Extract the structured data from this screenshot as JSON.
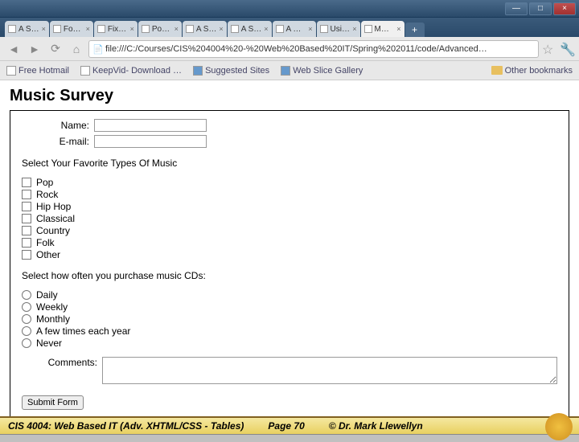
{
  "window": {
    "buttons": {
      "min": "—",
      "max": "□",
      "close": "×"
    }
  },
  "tabs": [
    {
      "label": "A S…"
    },
    {
      "label": "Fo…"
    },
    {
      "label": "Fix…"
    },
    {
      "label": "Po…"
    },
    {
      "label": "A S…"
    },
    {
      "label": "A S…"
    },
    {
      "label": "A …"
    },
    {
      "label": "Usi…"
    },
    {
      "label": "M…",
      "active": true
    }
  ],
  "nav": {
    "back": "◄",
    "forward": "►",
    "reload": "⟳",
    "home": "⌂",
    "url": "file:///C:/Courses/CIS%204004%20-%20Web%20Based%20IT/Spring%202011/code/Advanced…",
    "star": "☆",
    "wrench": "🔧"
  },
  "bookmarks": {
    "items": [
      {
        "label": "Free Hotmail"
      },
      {
        "label": "KeepVid- Download …"
      },
      {
        "label": "Suggested Sites",
        "icon": "ie"
      },
      {
        "label": "Web Slice Gallery",
        "icon": "ie"
      }
    ],
    "other": "Other bookmarks"
  },
  "page": {
    "title": "Music Survey",
    "name_label": "Name:",
    "email_label": "E-mail:",
    "music_prompt": "Select Your Favorite Types Of Music",
    "music_options": [
      "Pop",
      "Rock",
      "Hip Hop",
      "Classical",
      "Country",
      "Folk",
      "Other"
    ],
    "cd_prompt": "Select how often you purchase music CDs:",
    "cd_options": [
      "Daily",
      "Weekly",
      "Monthly",
      "A few times each year",
      "Never"
    ],
    "comments_label": "Comments:",
    "submit": "Submit Form"
  },
  "footer": {
    "course": "CIS 4004: Web Based IT (Adv. XHTML/CSS - Tables)",
    "page": "Page 70",
    "copyright": "© Dr. Mark Llewellyn"
  }
}
